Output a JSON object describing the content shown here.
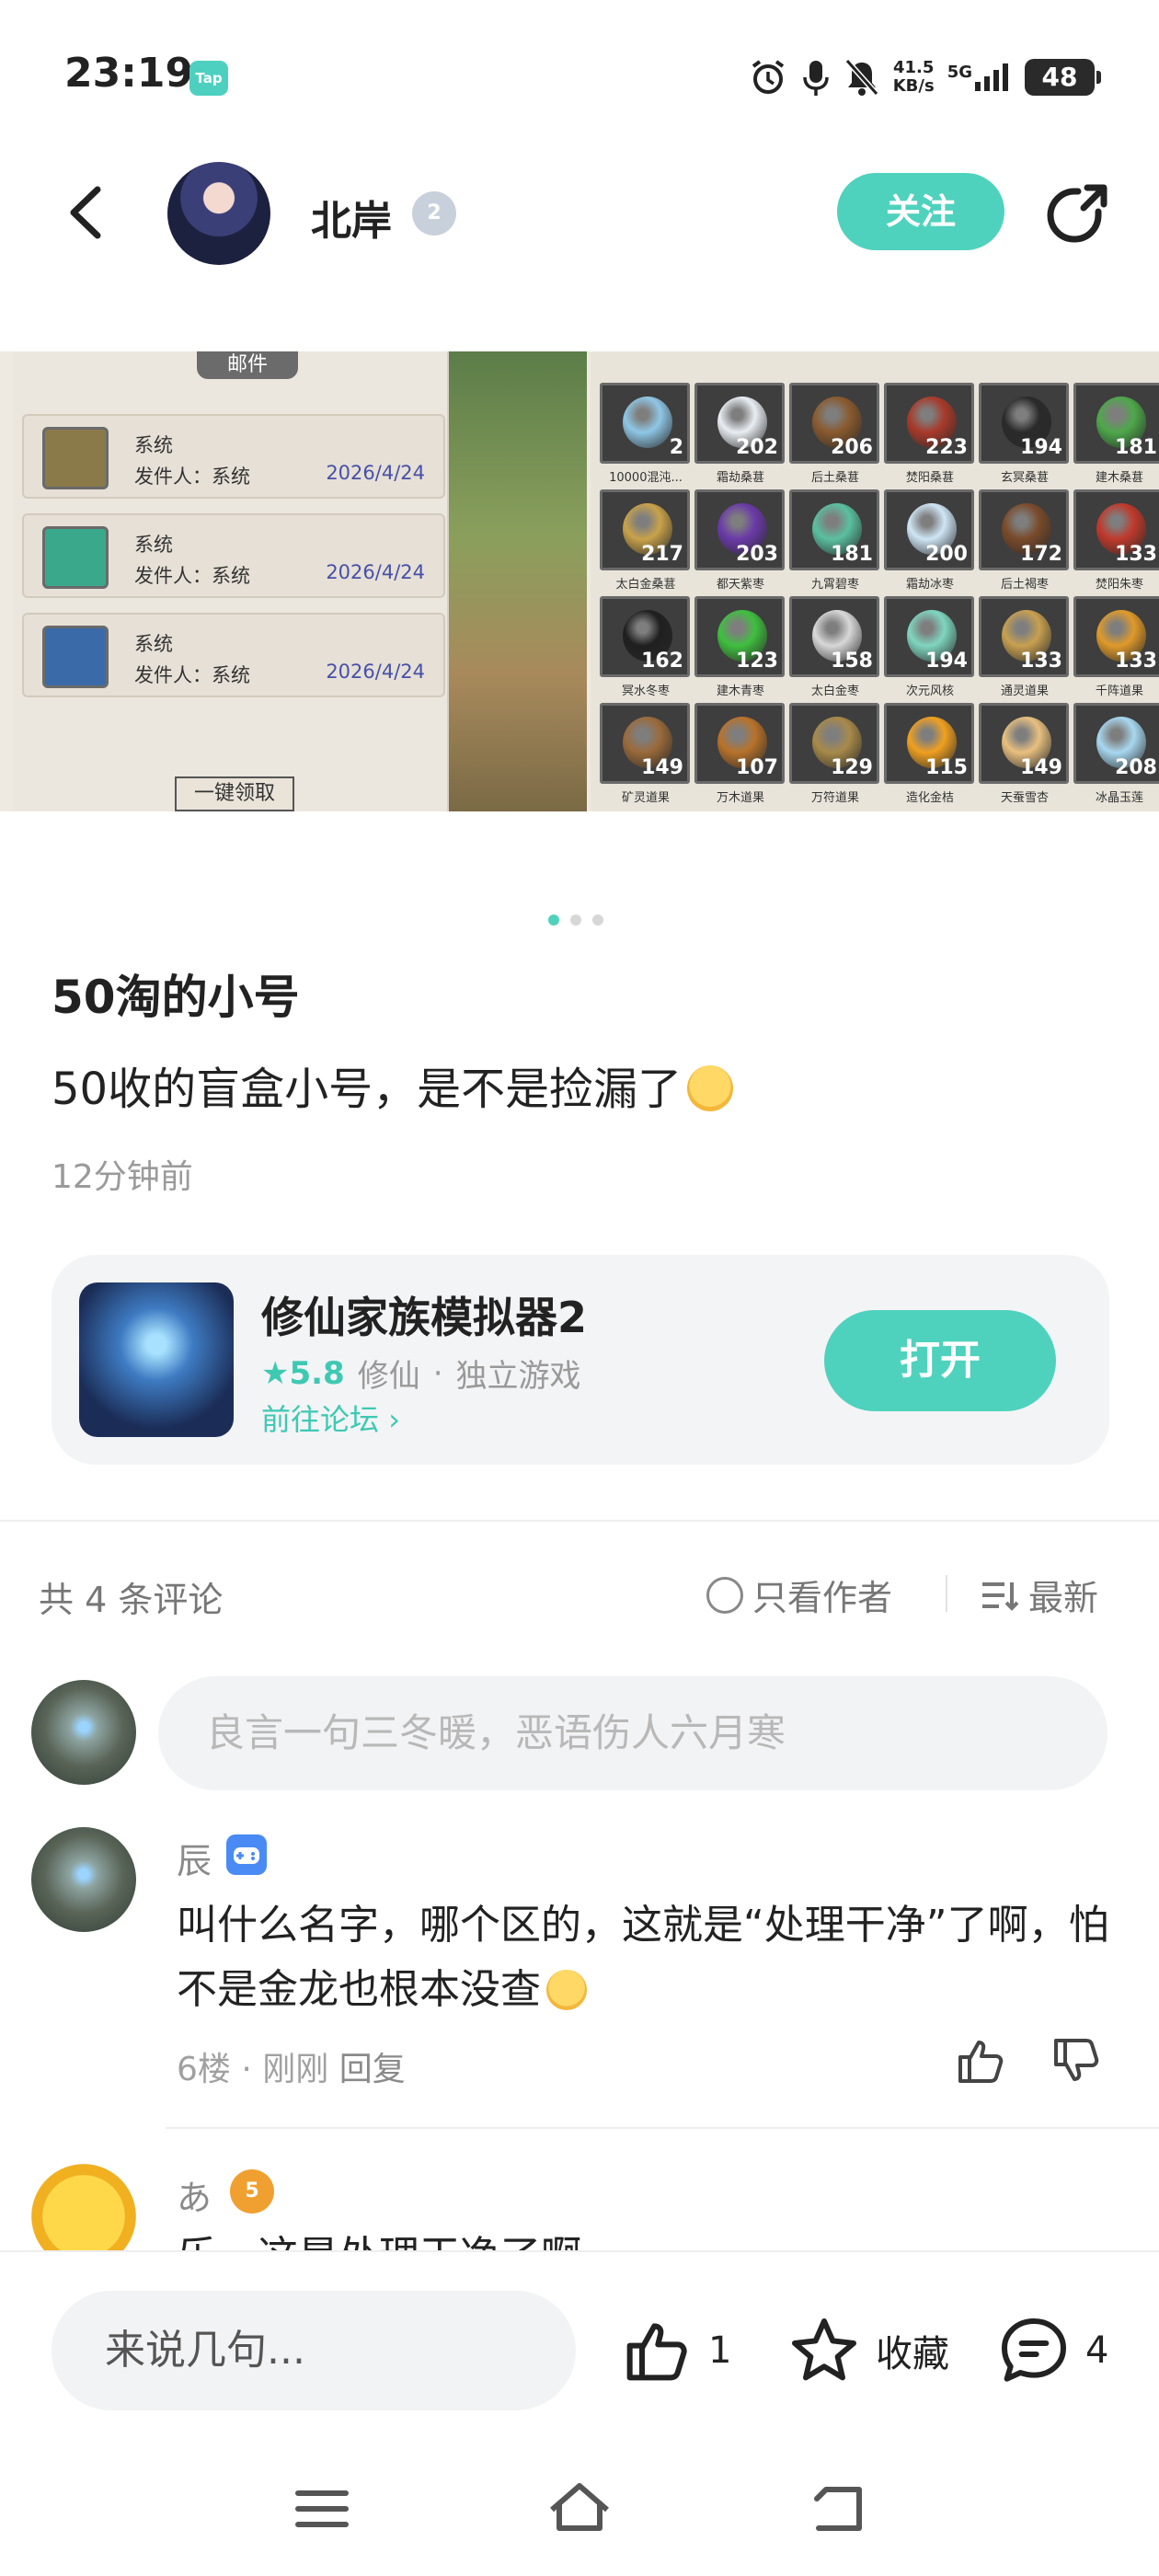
{
  "status_bar": {
    "time": "23:19",
    "app_badge": "Tap",
    "net_speed_value": "41.5",
    "net_speed_unit": "KB/s",
    "network": "5G",
    "battery": "48"
  },
  "header": {
    "username": "北岸",
    "level": "2",
    "follow_label": "关注"
  },
  "carousel": {
    "mail_title": "邮件",
    "mail_items": [
      {
        "title": "系统",
        "sender": "发件人：系统",
        "date": "2026/4/24"
      },
      {
        "title": "系统",
        "sender": "发件人：系统",
        "date": "2026/4/24"
      },
      {
        "title": "系统",
        "sender": "发件人：系统",
        "date": "2026/4/24"
      }
    ],
    "claim_all": "一键领取",
    "inventory": [
      {
        "count": "2",
        "name": "10000混沌...",
        "color": "#8fc7e6"
      },
      {
        "count": "202",
        "name": "霜劫桑葚",
        "color": "#e8eef3"
      },
      {
        "count": "206",
        "name": "后土桑葚",
        "color": "#8a5a2e"
      },
      {
        "count": "223",
        "name": "焚阳桑葚",
        "color": "#a83a2a"
      },
      {
        "count": "194",
        "name": "玄冥桑葚",
        "color": "#2a2a2a"
      },
      {
        "count": "181",
        "name": "建木桑葚",
        "color": "#4ea84a"
      },
      {
        "count": "217",
        "name": "太白金桑葚",
        "color": "#c9a24a"
      },
      {
        "count": "203",
        "name": "都天紫枣",
        "color": "#6a3aa8"
      },
      {
        "count": "181",
        "name": "九霄碧枣",
        "color": "#5ac0a0"
      },
      {
        "count": "200",
        "name": "霜劫冰枣",
        "color": "#cfe6f5"
      },
      {
        "count": "172",
        "name": "后土褐枣",
        "color": "#7a4a2a"
      },
      {
        "count": "133",
        "name": "焚阳朱枣",
        "color": "#c0392b"
      },
      {
        "count": "162",
        "name": "冥水冬枣",
        "color": "#1f1f1f"
      },
      {
        "count": "123",
        "name": "建木青枣",
        "color": "#3fbf3f"
      },
      {
        "count": "158",
        "name": "太白金枣",
        "color": "#d8d8d8"
      },
      {
        "count": "194",
        "name": "次元风核",
        "color": "#7fd6c0"
      },
      {
        "count": "133",
        "name": "通灵道果",
        "color": "#c8a050"
      },
      {
        "count": "133",
        "name": "千阵道果",
        "color": "#e09a2a"
      },
      {
        "count": "149",
        "name": "矿灵道果",
        "color": "#9a6a3a"
      },
      {
        "count": "107",
        "name": "万木道果",
        "color": "#b8722a"
      },
      {
        "count": "129",
        "name": "万符道果",
        "color": "#a88a4a"
      },
      {
        "count": "115",
        "name": "造化金桔",
        "color": "#f0a020"
      },
      {
        "count": "149",
        "name": "天蚕雪杏",
        "color": "#e8c080"
      },
      {
        "count": "208",
        "name": "冰晶玉莲",
        "color": "#a8d8f0"
      }
    ]
  },
  "post": {
    "title": "50淘的小号",
    "body": "50收的盲盒小号，是不是捡漏了",
    "time": "12分钟前"
  },
  "game_card": {
    "name": "修仙家族模拟器2",
    "rating": "5.8",
    "tag1": "修仙",
    "dot": "·",
    "tag2": "独立游戏",
    "forum_link": "前往论坛",
    "open_label": "打开"
  },
  "comments_header": {
    "count_text": "共 4 条评论",
    "only_author": "只看作者",
    "sort": "最新"
  },
  "comment_input_placeholder": "良言一句三冬暖，恶语伤人六月寒",
  "comments": [
    {
      "name": "辰",
      "text": "叫什么名字，哪个区的，这就是“处理干净”了啊，怕不是金龙也根本没查",
      "floor": "6楼",
      "dot": "·",
      "time": "刚刚",
      "reply": "回复"
    },
    {
      "name": "あ",
      "level": "5",
      "text": "乐，这是处理干净了啊"
    }
  ],
  "bottom_bar": {
    "say_placeholder": "来说几句...",
    "like_count": "1",
    "favorite_label": "收藏",
    "comment_count": "4"
  },
  "colors": {
    "accent": "#4fd2bd",
    "accent_text": "#3ec9b3"
  }
}
